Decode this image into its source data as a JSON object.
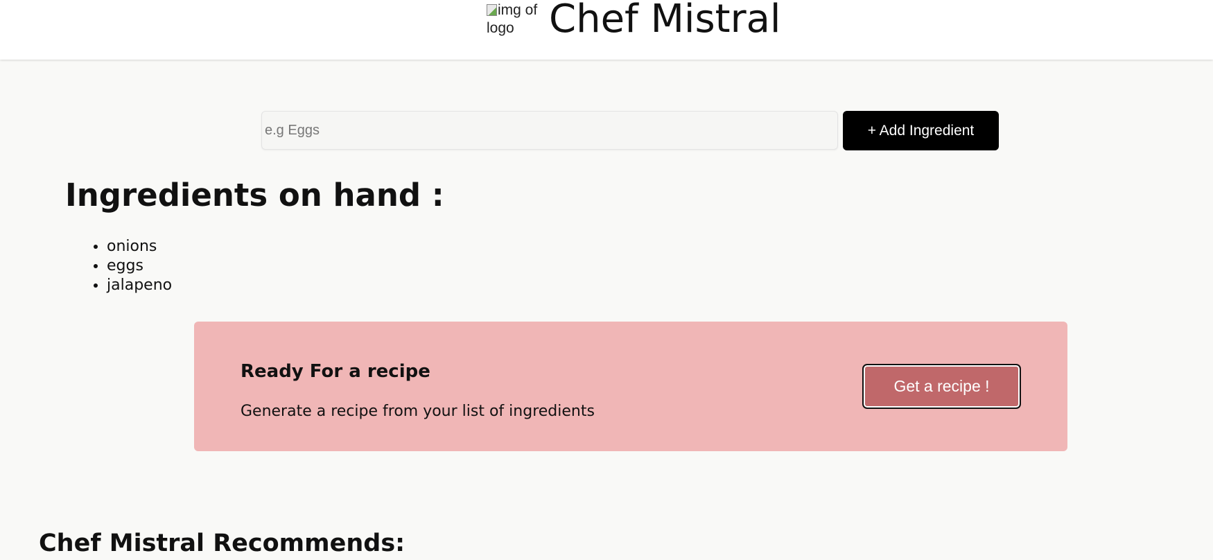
{
  "header": {
    "logo_alt": "img of logo",
    "title": "Chef Mistral"
  },
  "form": {
    "input_placeholder": "e.g Eggs",
    "input_value": "",
    "add_button_label": "+ Add Ingredient"
  },
  "ingredients": {
    "heading": "Ingredients on hand :",
    "items": [
      "onions",
      "eggs",
      "jalapeno"
    ]
  },
  "recipe_card": {
    "title": "Ready For a recipe",
    "subtitle": "Generate a recipe from your list of ingredients",
    "button_label": "Get a recipe !",
    "background_color": "#f0b6b6",
    "button_color": "#c0686a"
  },
  "recommends": {
    "heading": "Chef Mistral Recommends:"
  }
}
